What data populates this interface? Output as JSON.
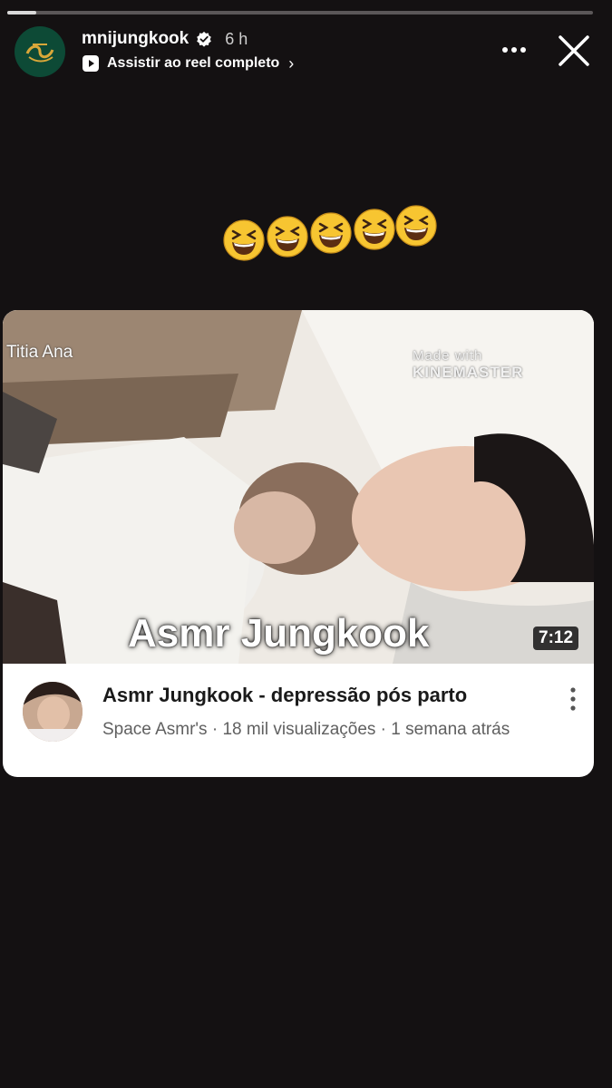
{
  "story": {
    "progress_fraction": 0.05,
    "username": "mnijungkook",
    "time": "6 h",
    "reel_link_label": "Assistir ao reel completo",
    "emojis_count": 5
  },
  "icons": {
    "verified": "verified-badge-icon",
    "reel": "play-reel-icon",
    "more": "more-options-icon",
    "close": "close-icon",
    "emoji": "grinning-squinting-face"
  },
  "video_card": {
    "thumbnail_watermark_left": "Titia Ana",
    "thumbnail_watermark_right_prefix": "Made with",
    "thumbnail_watermark_right_brand": "KINEMASTER",
    "thumbnail_title": "Asmr Jungkook",
    "duration": "7:12",
    "title": "Asmr Jungkook - depressão pós parto",
    "meta": "Space Asmr's · 18 mil visualizações · 1 semana atrás"
  },
  "colors": {
    "background": "#141112",
    "card": "#ffffff",
    "emoji_face": "#f7c531"
  }
}
